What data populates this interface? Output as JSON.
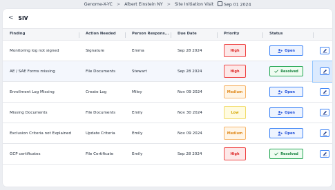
{
  "breadcrumb": {
    "items": [
      "Genome-X-YC",
      "Albert Einstein NY",
      "Site Initiation Visit"
    ],
    "separator": ">",
    "date": "Sep 01 2024"
  },
  "page": {
    "back_label": "<",
    "title": "SIV"
  },
  "table": {
    "columns": [
      "Finding",
      "Action Needed",
      "Person Respons...",
      "Due Date",
      "Priority",
      "Status",
      ""
    ],
    "rows": [
      {
        "finding": "Monitoring log not signed",
        "action": "Signature",
        "person": "Emma",
        "due": "Sep 28 2024",
        "priority": "High",
        "status": "Open",
        "selected": false
      },
      {
        "finding": "AE / SAE Forms missing",
        "action": "File Documents",
        "person": "Stewart",
        "due": "Sep 28 2024",
        "priority": "High",
        "status": "Resolved",
        "selected": true
      },
      {
        "finding": "Enrollment Log Missing",
        "action": "Create Log",
        "person": "Miley",
        "due": "Nov 09 2024",
        "priority": "Medium",
        "status": "Open",
        "selected": false
      },
      {
        "finding": "Missing Documents",
        "action": "File Documents",
        "person": "Emily",
        "due": "Nov 30 2024",
        "priority": "Low",
        "status": "Open",
        "selected": false
      },
      {
        "finding": "Exclusion Criteria not Explained",
        "action": "Update Criteria",
        "person": "Emily",
        "due": "Nov 09 2024",
        "priority": "Medium",
        "status": "Open",
        "selected": false
      },
      {
        "finding": "GCP certificates",
        "action": "File Certificate",
        "person": "Emily",
        "due": "Sep 28 2024",
        "priority": "High",
        "status": "Resolved",
        "selected": false
      }
    ]
  },
  "colors": {
    "high": {
      "bg": "#fde8e8",
      "border": "#ef4444",
      "text": "#dc2626"
    },
    "medium": {
      "bg": "#fff5e6",
      "border": "#f6b56b",
      "text": "#e08a1e"
    },
    "low": {
      "bg": "#fffbe0",
      "border": "#f1dc6a",
      "text": "#d4a600"
    }
  },
  "icons": {
    "open": "user-plus-icon",
    "resolved": "check-icon",
    "edit": "pencil-icon",
    "date": "calendar-icon"
  }
}
